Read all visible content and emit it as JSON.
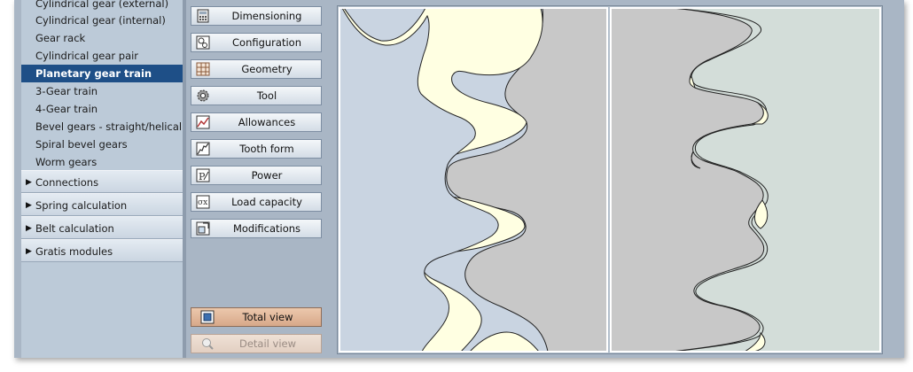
{
  "sidebar": {
    "items": [
      {
        "label": "Cylindrical gear (external)"
      },
      {
        "label": "Cylindrical gear (internal)"
      },
      {
        "label": "Gear rack"
      },
      {
        "label": "Cylindrical gear pair"
      },
      {
        "label": "Planetary gear train",
        "selected": true
      },
      {
        "label": "3-Gear train"
      },
      {
        "label": "4-Gear train"
      },
      {
        "label": "Bevel gears - straight/helical"
      },
      {
        "label": "Spiral bevel gears"
      },
      {
        "label": "Worm gears"
      }
    ],
    "categories": [
      {
        "label": "Connections"
      },
      {
        "label": "Spring calculation"
      },
      {
        "label": "Belt calculation"
      },
      {
        "label": "Gratis modules"
      }
    ]
  },
  "modules": {
    "buttons": [
      {
        "label": "Dimensioning",
        "icon": "dimensioning-icon"
      },
      {
        "label": "Configuration",
        "icon": "configuration-icon"
      },
      {
        "label": "Geometry",
        "icon": "geometry-icon"
      },
      {
        "label": "Tool",
        "icon": "tool-icon"
      },
      {
        "label": "Allowances",
        "icon": "allowances-icon"
      },
      {
        "label": "Tooth form",
        "icon": "tooth-form-icon"
      },
      {
        "label": "Power",
        "icon": "power-icon"
      },
      {
        "label": "Load capacity",
        "icon": "load-capacity-icon"
      },
      {
        "label": "Modifications",
        "icon": "modifications-icon"
      }
    ]
  },
  "view": {
    "total_label": "Total view",
    "detail_label": "Detail view"
  },
  "colors": {
    "selected": "#1e4f87",
    "gear_blue": "#c9d4e1",
    "gear_gray": "#c8c8c8",
    "gear_green": "#d3ddd9",
    "gear_fill_cream": "#ffffe2"
  }
}
